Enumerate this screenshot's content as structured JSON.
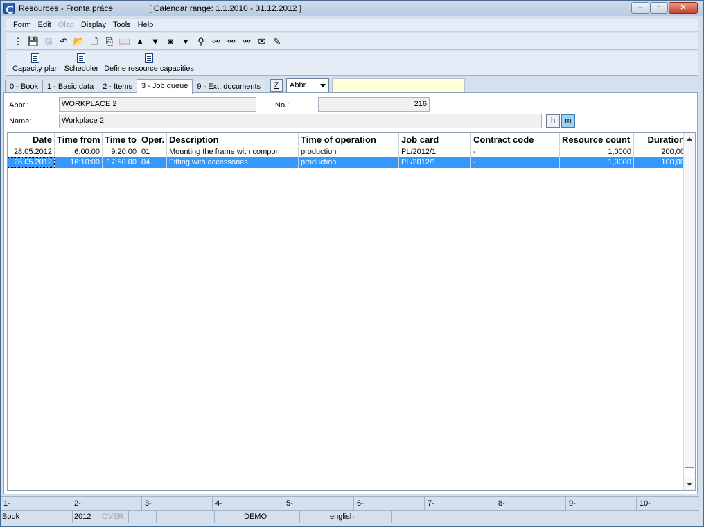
{
  "window": {
    "title": "Resources - Fronta práce",
    "calendar_range": "[ Calendar range: 1.1.2010 - 31.12.2012 ]"
  },
  "window_controls": {
    "minimize": "–",
    "maximize": "▫",
    "close": "✕"
  },
  "menu": [
    {
      "label": "Form",
      "disabled": false
    },
    {
      "label": "Edit",
      "disabled": false
    },
    {
      "label": "Olap",
      "disabled": true
    },
    {
      "label": "Display",
      "disabled": false
    },
    {
      "label": "Tools",
      "disabled": false
    },
    {
      "label": "Help",
      "disabled": false
    }
  ],
  "toolbar": [
    {
      "name": "tree-view-icon",
      "glyph": "⋮",
      "disabled": false
    },
    {
      "name": "save-icon",
      "glyph": "💾",
      "disabled": true
    },
    {
      "name": "save-as-icon",
      "glyph": "🖫",
      "disabled": true
    },
    {
      "name": "undo-icon",
      "glyph": "↶",
      "disabled": false
    },
    {
      "name": "open-folder-icon",
      "glyph": "📂",
      "disabled": false
    },
    {
      "name": "new-document-icon",
      "glyph": "🗋",
      "disabled": false
    },
    {
      "name": "copy-icon",
      "glyph": "⎘",
      "disabled": false
    },
    {
      "name": "book-icon",
      "glyph": "📖",
      "disabled": false
    },
    {
      "name": "arrow-up-icon",
      "glyph": "▲",
      "disabled": false
    },
    {
      "name": "arrow-down-icon",
      "glyph": "▼",
      "disabled": false
    },
    {
      "name": "camera-icon",
      "glyph": "◙",
      "disabled": false
    },
    {
      "name": "dropdown-arrow-icon",
      "glyph": "▾",
      "disabled": false
    },
    {
      "name": "filter-icon",
      "glyph": "⚲",
      "disabled": false
    },
    {
      "name": "binoculars-icon",
      "glyph": "⚯",
      "disabled": false
    },
    {
      "name": "find-next-icon",
      "glyph": "⚯",
      "disabled": false
    },
    {
      "name": "find-replace-icon",
      "glyph": "⚯",
      "disabled": false
    },
    {
      "name": "mail-icon",
      "glyph": "✉",
      "disabled": false
    },
    {
      "name": "notes-icon",
      "glyph": "✎",
      "disabled": false
    }
  ],
  "ribbon": [
    {
      "label": "Capacity plan"
    },
    {
      "label": "Scheduler"
    },
    {
      "label": "Define resource capacities"
    }
  ],
  "tabs": [
    {
      "label": "0 - Book",
      "active": false
    },
    {
      "label": "1 - Basic data",
      "active": false
    },
    {
      "label": "2 - Items",
      "active": false
    },
    {
      "label": "3 - Job queue",
      "active": true
    },
    {
      "label": "9 - Ext. documents",
      "active": false
    }
  ],
  "filter": {
    "z_label": "Z",
    "select_value": "Abbr.",
    "search_value": ""
  },
  "form": {
    "abbr_label": "Abbr.:",
    "abbr_value": "WORKPLACE 2",
    "no_label": "No.:",
    "no_value": "216",
    "name_label": "Name:",
    "name_value": "Workplace 2",
    "unit_h": "h",
    "unit_m": "m"
  },
  "grid": {
    "columns": [
      "Date",
      "Time from",
      "Time to",
      "Oper.",
      "Description",
      "Time of operation",
      "Job card",
      "Contract code",
      "Resource count",
      "Duration"
    ],
    "rows": [
      [
        "28.05.2012",
        "6:00:00",
        "9:20:00",
        "01",
        "Mounting the frame with compon",
        "production",
        "PL/2012/1",
        "-",
        "1,0000",
        "200,00"
      ],
      [
        "28.05.2012",
        "16:10:00",
        "17:50:00",
        "04",
        "Fitting with accessories",
        "production",
        "PL/2012/1",
        "-",
        "1,0000",
        "100,00"
      ]
    ],
    "selected_row": 1
  },
  "function_keys": [
    "1-",
    "2-",
    "3-",
    "4-",
    "5-",
    "6-",
    "7-",
    "8-",
    "9-",
    "10-"
  ],
  "status": {
    "book": "Book",
    "year": "2012",
    "mode": "OVER",
    "database": "DEMO",
    "language": "english"
  }
}
